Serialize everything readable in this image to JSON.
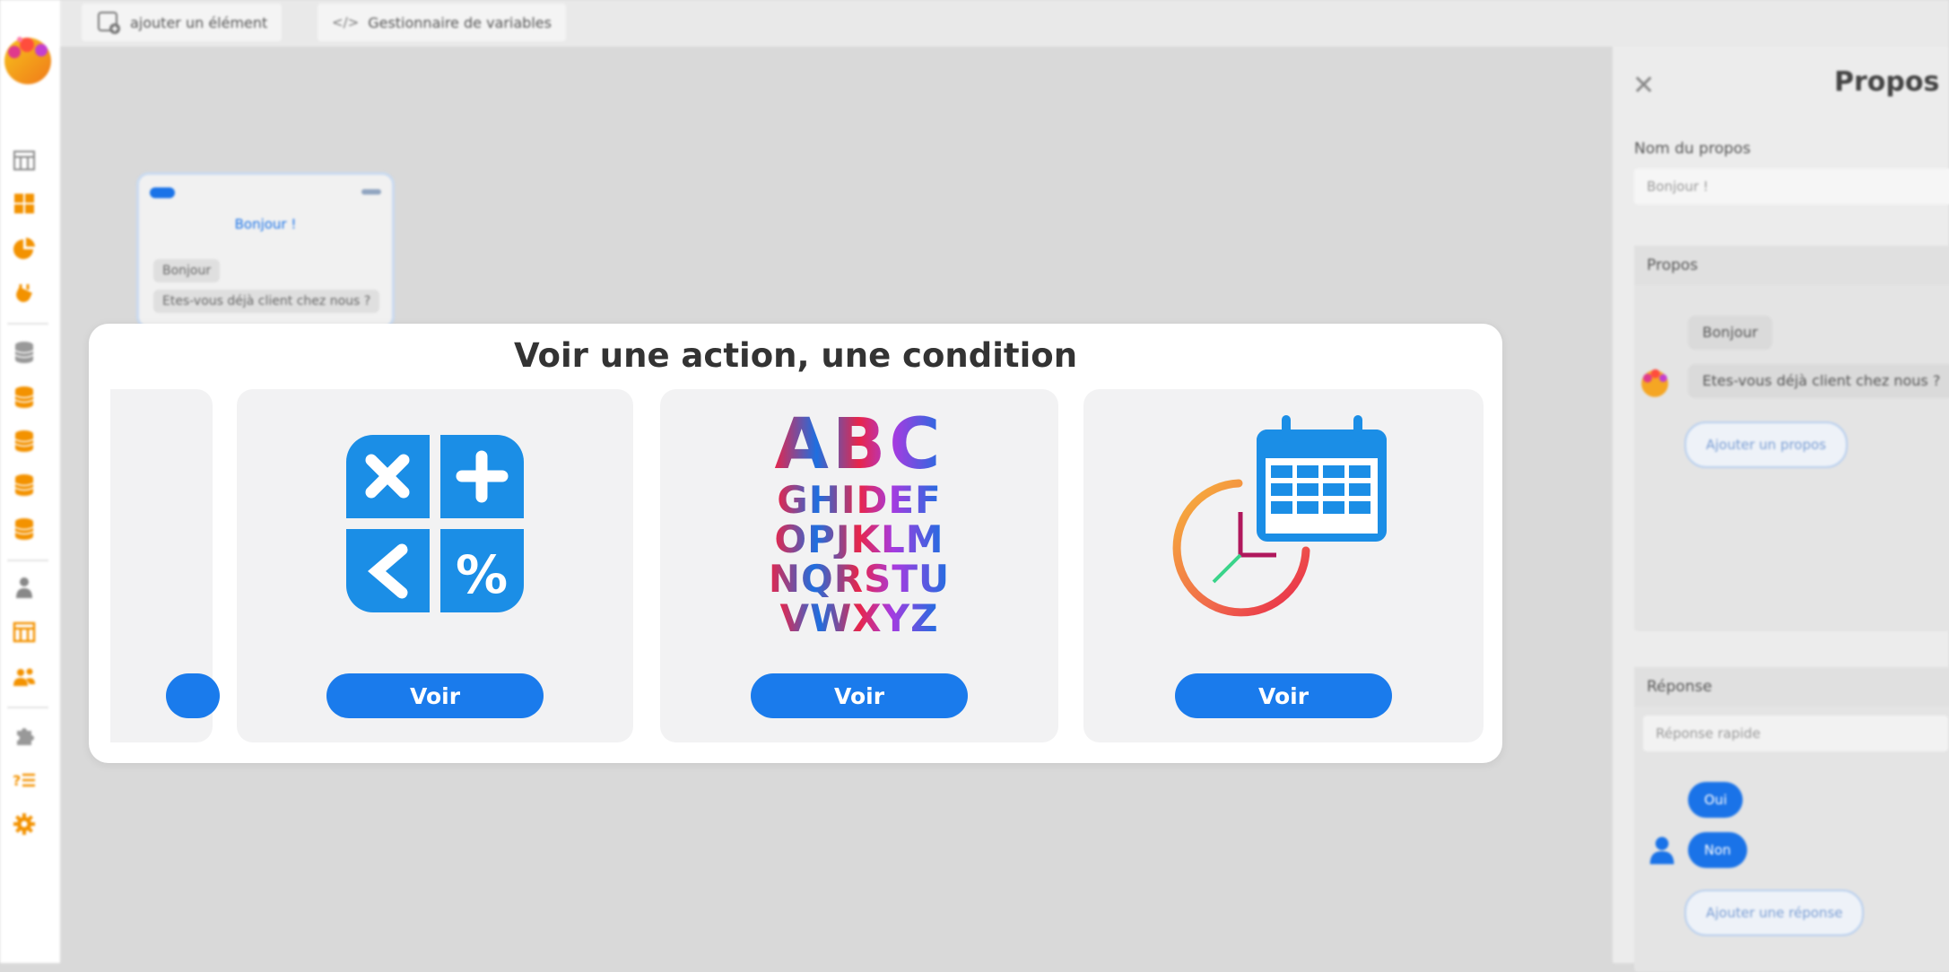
{
  "topbar": {
    "add_element_label": "ajouter un élément",
    "variables_label": "Gestionnaire de variables"
  },
  "sidebar": {
    "icons": [
      "grid-icon",
      "dashboard-icon",
      "chart-icon",
      "plug-icon",
      "database-icon",
      "database-icon",
      "database-icon",
      "database-icon",
      "database-icon",
      "user-icon",
      "building-icon",
      "team-icon",
      "puzzle-icon",
      "faq-icon",
      "gear-icon"
    ]
  },
  "canvas_node": {
    "title": "Bonjour !",
    "bubbles": [
      "Bonjour",
      "Etes-vous déjà client chez nous ?"
    ]
  },
  "right_panel": {
    "title": "Propos",
    "name_label": "Nom du propos",
    "name_value": "Bonjour !",
    "propos_section": "Propos",
    "propos_items": [
      "Bonjour",
      "Etes-vous déjà client chez nous ?"
    ],
    "add_propos": "Ajouter un propos",
    "response_section": "Réponse",
    "response_type": "Réponse rapide",
    "responses": [
      "Oui",
      "Non"
    ],
    "add_response": "Ajouter une réponse"
  },
  "modal": {
    "title": "Voir une action, une condition",
    "cards": [
      {
        "art": "calculator-icon",
        "button": "Voir"
      },
      {
        "art": "alphabet-icon",
        "lines": [
          "ABC",
          "GHIDEF",
          "OPJKLM",
          "NQRSTU",
          "VWXYZ"
        ],
        "button": "Voir"
      },
      {
        "art": "calendar-clock-icon",
        "button": "Voir"
      }
    ]
  },
  "colors": {
    "accent": "#1a7bec",
    "sidebar_icon": "#f39200"
  }
}
